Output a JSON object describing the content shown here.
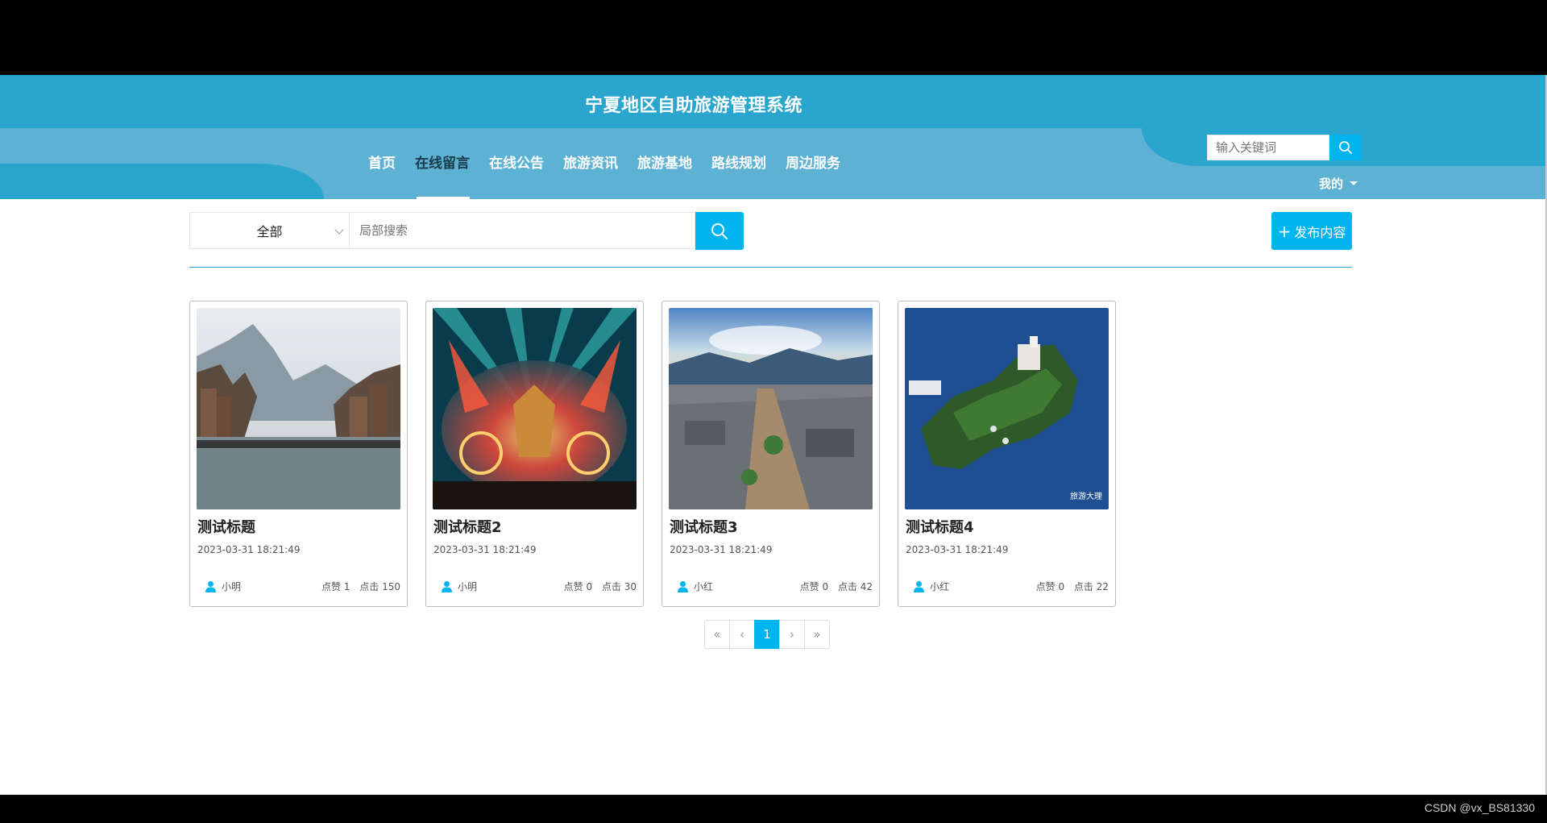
{
  "site": {
    "title": "宁夏地区自助旅游管理系统"
  },
  "nav": {
    "items": [
      {
        "label": "首页"
      },
      {
        "label": "在线留言"
      },
      {
        "label": "在线公告"
      },
      {
        "label": "旅游资讯"
      },
      {
        "label": "旅游基地"
      },
      {
        "label": "路线规划"
      },
      {
        "label": "周边服务"
      }
    ],
    "active_index": 1,
    "search_placeholder": "输入关键词",
    "user_menu": "我的"
  },
  "toolbar": {
    "category_selected": "全部",
    "search_placeholder": "局部搜索",
    "publish_label": "发布内容",
    "publish_icon": "+"
  },
  "cards": [
    {
      "title": "测试标题",
      "date": "2023-03-31 18:21:49",
      "author": "小明",
      "likes": "点赞 1",
      "clicks": "点击 150",
      "image": "river-town-photo"
    },
    {
      "title": "测试标题2",
      "date": "2023-03-31 18:21:49",
      "author": "小明",
      "likes": "点赞 0",
      "clicks": "点击 30",
      "image": "music-festival-stage-photo"
    },
    {
      "title": "测试标题3",
      "date": "2023-03-31 18:21:49",
      "author": "小红",
      "likes": "点赞 0",
      "clicks": "点击 42",
      "image": "old-town-aerial-photo"
    },
    {
      "title": "测试标题4",
      "date": "2023-03-31 18:21:49",
      "author": "小红",
      "likes": "点赞 0",
      "clicks": "点击 22",
      "image": "island-aerial-photo",
      "image_watermark": "旅游大理"
    }
  ],
  "pagination": {
    "first": "«",
    "prev": "‹",
    "current": "1",
    "next": "›",
    "last": "»"
  },
  "watermark": "CSDN @vx_BS81330",
  "colors": {
    "header": "#2aa5cd",
    "nav": "#5db2d4",
    "accent": "#00b4ef"
  }
}
